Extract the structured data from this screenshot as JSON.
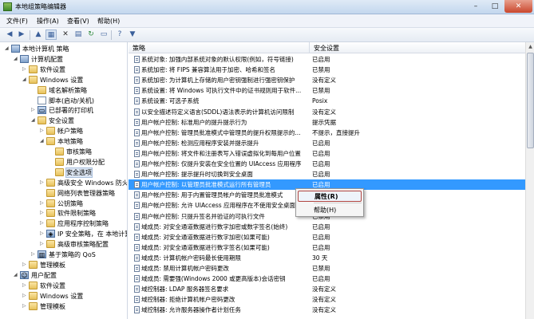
{
  "window": {
    "title": "本地组策略编辑器",
    "controls": {
      "minimize": "–",
      "maximize": "□",
      "close": "✕"
    }
  },
  "menu": [
    "文件(F)",
    "操作(A)",
    "查看(V)",
    "帮助(H)"
  ],
  "toolbar_icons": [
    "back-arrow-icon",
    "forward-arrow-icon",
    "up-folder-icon",
    "show-hide-tree-icon",
    "delete-icon",
    "properties-icon",
    "refresh-icon",
    "export-list-icon",
    "help-icon",
    "filter-icon"
  ],
  "tree": [
    {
      "label": "本地计算机 策略",
      "level": 0,
      "icon": "computer-policy-icon",
      "expander": "◢"
    },
    {
      "label": "计算机配置",
      "level": 1,
      "icon": "computer-icon",
      "expander": "◢"
    },
    {
      "label": "软件设置",
      "level": 2,
      "icon": "folder-icon",
      "expander": "▷"
    },
    {
      "label": "Windows 设置",
      "level": 2,
      "icon": "folder-icon",
      "expander": "◢"
    },
    {
      "label": "域名解析策略",
      "level": 3,
      "icon": "folder-icon",
      "expander": ""
    },
    {
      "label": "脚本(启动/关机)",
      "level": 3,
      "icon": "document-icon",
      "expander": ""
    },
    {
      "label": "已部署的打印机",
      "level": 3,
      "icon": "printer-icon",
      "expander": "▷"
    },
    {
      "label": "安全设置",
      "level": 3,
      "icon": "folder-icon",
      "expander": "◢"
    },
    {
      "label": "帐户策略",
      "level": 4,
      "icon": "folder-icon",
      "expander": "▷"
    },
    {
      "label": "本地策略",
      "level": 4,
      "icon": "folder-icon",
      "expander": "◢"
    },
    {
      "label": "审核策略",
      "level": 5,
      "icon": "folder-icon",
      "expander": ""
    },
    {
      "label": "用户权限分配",
      "level": 5,
      "icon": "folder-icon",
      "expander": ""
    },
    {
      "label": "安全选项",
      "level": 5,
      "icon": "folder-icon",
      "expander": "",
      "selected": true
    },
    {
      "label": "高级安全 Windows 防火墙",
      "level": 4,
      "icon": "folder-icon",
      "expander": "▷"
    },
    {
      "label": "网络列表管理器策略",
      "level": 4,
      "icon": "folder-icon",
      "expander": ""
    },
    {
      "label": "公钥策略",
      "level": 4,
      "icon": "folder-icon",
      "expander": "▷"
    },
    {
      "label": "软件限制策略",
      "level": 4,
      "icon": "folder-icon",
      "expander": "▷"
    },
    {
      "label": "应用程序控制策略",
      "level": 4,
      "icon": "folder-icon",
      "expander": "▷"
    },
    {
      "label": "IP 安全策略，在 本地计算机",
      "level": 4,
      "icon": "ip-security-icon",
      "expander": "▷"
    },
    {
      "label": "高级审核策略配置",
      "level": 4,
      "icon": "folder-icon",
      "expander": "▷"
    },
    {
      "label": "基于策略的 QoS",
      "level": 3,
      "icon": "chart-icon",
      "expander": "▷"
    },
    {
      "label": "管理模板",
      "level": 2,
      "icon": "folder-icon",
      "expander": "▷"
    },
    {
      "label": "用户配置",
      "level": 1,
      "icon": "user-icon",
      "expander": "◢"
    },
    {
      "label": "软件设置",
      "level": 2,
      "icon": "folder-icon",
      "expander": "▷"
    },
    {
      "label": "Windows 设置",
      "level": 2,
      "icon": "folder-icon",
      "expander": "▷"
    },
    {
      "label": "管理模板",
      "level": 2,
      "icon": "folder-icon",
      "expander": "▷"
    }
  ],
  "columns": {
    "policy": "策略",
    "setting": "安全设置"
  },
  "policies": [
    {
      "name": "系统对象: 加强内部系统对象的默认权限(例如，符号链接)",
      "setting": "已启用"
    },
    {
      "name": "系统加密: 将 FIPS 兼容算法用于加密、哈希和签名",
      "setting": "已禁用"
    },
    {
      "name": "系统加密: 为计算机上存储的用户密钥强制进行强密钥保护",
      "setting": "没有定义"
    },
    {
      "name": "系统设置: 将 Windows 可执行文件中的证书规则用于软件...",
      "setting": "已禁用"
    },
    {
      "name": "系统设置: 可选子系统",
      "setting": "Posix"
    },
    {
      "name": "以安全描述符定义语言(SDDL)语法表示的计算机访问限制",
      "setting": "没有定义"
    },
    {
      "name": "用户帐户控制: 标准用户的提升提示行为",
      "setting": "提示凭据"
    },
    {
      "name": "用户帐户控制: 管理员批准模式中管理员的提升权限提示的...",
      "setting": "不提示，直接提升"
    },
    {
      "name": "用户帐户控制: 检测应用程序安装并提示提升",
      "setting": "已启用"
    },
    {
      "name": "用户帐户控制: 将文件和注册表写入错误虚拟化到每用户位置",
      "setting": "已启用"
    },
    {
      "name": "用户帐户控制: 仅提升安装在安全位置的 UIAccess 应用程序",
      "setting": "已启用"
    },
    {
      "name": "用户帐户控制: 提示提升时切换到安全桌面",
      "setting": "已启用"
    },
    {
      "name": "用户帐户控制: 以管理员批准模式运行所有管理员",
      "setting": "已启用",
      "selected": true
    },
    {
      "name": "用户帐户控制: 用于内置管理员帐户的管理员批准模式",
      "setting": "已禁用"
    },
    {
      "name": "用户帐户控制: 允许 UIAccess 应用程序在不使用安全桌面...",
      "setting": "已禁用"
    },
    {
      "name": "用户帐户控制: 只提升签名并验证的可执行文件",
      "setting": "已禁用"
    },
    {
      "name": "域成员: 对安全通道数据进行数字加密或数字签名(始终)",
      "setting": "已启用"
    },
    {
      "name": "域成员: 对安全通道数据进行数字加密(如果可能)",
      "setting": "已启用"
    },
    {
      "name": "域成员: 对安全通道数据进行数字签名(如果可能)",
      "setting": "已启用"
    },
    {
      "name": "域成员: 计算机帐户密码最长使用期限",
      "setting": "30 天"
    },
    {
      "name": "域成员: 禁用计算机帐户密码更改",
      "setting": "已禁用"
    },
    {
      "name": "域成员: 需要强(Windows 2000 或更高版本)会话密钥",
      "setting": "已启用"
    },
    {
      "name": "域控制器: LDAP 服务器签名要求",
      "setting": "没有定义"
    },
    {
      "name": "域控制器: 拒绝计算机帐户密码更改",
      "setting": "没有定义"
    },
    {
      "name": "域控制器: 允许服务器操作者计划任务",
      "setting": "没有定义"
    }
  ],
  "context_menu": {
    "properties": "属性(R)",
    "help": "帮助(H)"
  }
}
